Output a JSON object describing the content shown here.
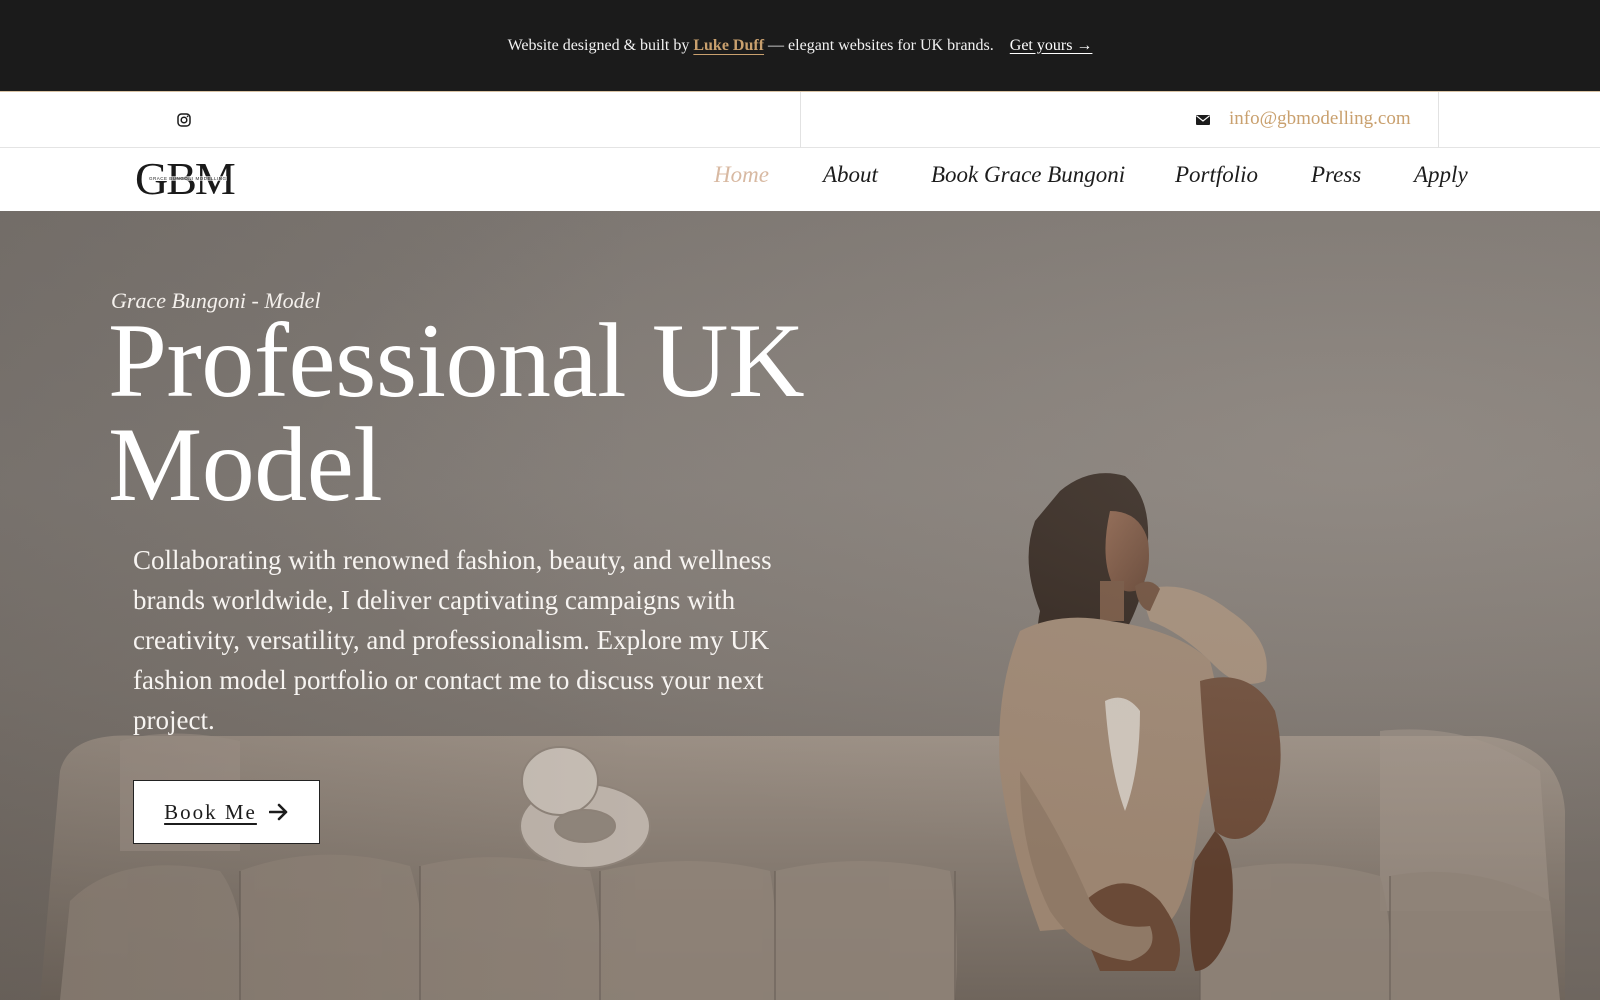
{
  "promo": {
    "prefix": "Website designed & built by",
    "credit_name": "Luke Duff",
    "suffix": "— elegant websites for UK brands.",
    "cta": "Get yours →"
  },
  "contact": {
    "instagram_icon": "instagram-icon",
    "mail_icon": "envelope-icon",
    "email": "info@gbmodelling.com"
  },
  "nav": {
    "logo_mark": "GBM",
    "logo_sub": "GRACE BUNGONI MODELLING",
    "items": [
      {
        "label": "Home",
        "active": true
      },
      {
        "label": "About"
      },
      {
        "label": "Book Grace Bungoni"
      },
      {
        "label": "Portfolio"
      },
      {
        "label": "Press"
      },
      {
        "label": "Apply"
      }
    ]
  },
  "hero": {
    "kicker": "Grace Bungoni - Model",
    "title": "Professional UK Model",
    "body": "Collaborating with renowned fashion, beauty, and wellness brands worldwide, I deliver captivating campaigns with creativity, versatility, and professionalism. Explore my UK fashion model portfolio or contact me to discuss your next project.",
    "cta_label": "Book Me",
    "cta_icon": "arrow-right-icon"
  },
  "colors": {
    "accent": "#c9a06e",
    "nav_active": "#d8b9a2",
    "banner_bg": "#1b1b1b"
  }
}
